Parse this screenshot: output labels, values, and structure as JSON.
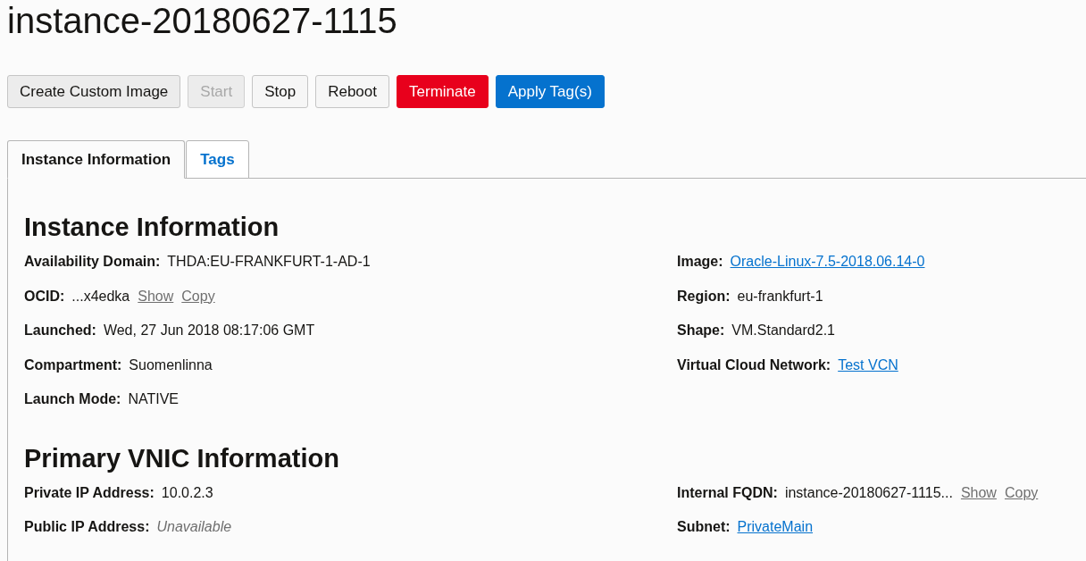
{
  "title": "instance-20180627-1115",
  "buttons": [
    {
      "label": "Create Custom Image",
      "kind": "default"
    },
    {
      "label": "Start",
      "kind": "disabled"
    },
    {
      "label": "Stop",
      "kind": "plain"
    },
    {
      "label": "Reboot",
      "kind": "plain"
    },
    {
      "label": "Terminate",
      "kind": "danger"
    },
    {
      "label": "Apply Tag(s)",
      "kind": "primary"
    }
  ],
  "tabs": [
    {
      "label": "Instance Information",
      "selected": true
    },
    {
      "label": "Tags",
      "selected": false
    }
  ],
  "sections": [
    {
      "heading": "Instance Information",
      "left": [
        {
          "label": "Availability Domain:",
          "value": "THDA:EU-FRANKFURT-1-AD-1",
          "kind": "text"
        },
        {
          "label": "OCID:",
          "value": "...x4edka",
          "kind": "text",
          "actions": [
            "Show",
            "Copy"
          ]
        },
        {
          "label": "Launched:",
          "value": "Wed, 27 Jun 2018 08:17:06 GMT",
          "kind": "text"
        },
        {
          "label": "Compartment:",
          "value": "Suomenlinna",
          "kind": "text"
        },
        {
          "label": "Launch Mode:",
          "value": "NATIVE",
          "kind": "text"
        }
      ],
      "right": [
        {
          "label": "Image:",
          "value": "Oracle-Linux-7.5-2018.06.14-0",
          "kind": "link"
        },
        {
          "label": "Region:",
          "value": "eu-frankfurt-1",
          "kind": "text"
        },
        {
          "label": "Shape:",
          "value": "VM.Standard2.1",
          "kind": "text"
        },
        {
          "label": "Virtual Cloud Network:",
          "value": "Test VCN",
          "kind": "link"
        }
      ]
    },
    {
      "heading": "Primary VNIC Information",
      "left": [
        {
          "label": "Private IP Address:",
          "value": "10.0.2.3",
          "kind": "text"
        },
        {
          "label": "Public IP Address:",
          "value": "Unavailable",
          "kind": "unavailable"
        }
      ],
      "right": [
        {
          "label": "Internal FQDN:",
          "value": "instance-20180627-1115...",
          "kind": "text",
          "actions": [
            "Show",
            "Copy"
          ]
        },
        {
          "label": "Subnet:",
          "value": "PrivateMain",
          "kind": "link"
        }
      ]
    }
  ]
}
